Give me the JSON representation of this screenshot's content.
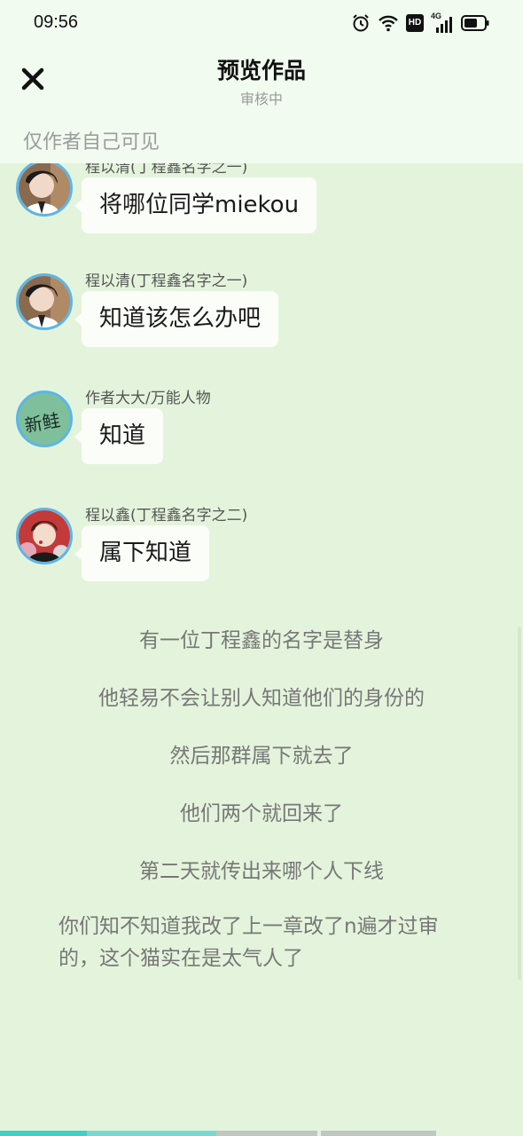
{
  "status_bar": {
    "time": "09:56",
    "icons": [
      "alarm-icon",
      "wifi-icon",
      "hd-icon",
      "signal-4g-icon",
      "battery-icon"
    ],
    "network_label": "4G",
    "hd_label": "HD"
  },
  "header": {
    "close_icon": "close-icon",
    "title": "预览作品",
    "subtitle": "审核中",
    "visibility": "仅作者自己可见"
  },
  "messages": [
    {
      "name": "程以清(丁程鑫名字之一)",
      "text": "将哪位同学miekou",
      "avatar": "avatar-boy-dark-hair"
    },
    {
      "name": "程以清(丁程鑫名字之一)",
      "text": "知道该怎么办吧",
      "avatar": "avatar-boy-dark-hair"
    },
    {
      "name": "作者大大/万能人物",
      "text": "知道",
      "avatar": "avatar-green-calligraphy"
    },
    {
      "name": "程以鑫(丁程鑫名字之二)",
      "text": "属下知道",
      "avatar": "avatar-boy-red-bg"
    }
  ],
  "narration": [
    "有一位丁程鑫的名字是替身",
    "他轻易不会让别人知道他们的身份的",
    "然后那群属下就去了",
    "他们两个就回来了",
    "第二天就传出来哪个人下线",
    "你们知不知道我改了上一章改了n遍才过审的，这个猫实在是太气人了"
  ],
  "avatar_text": "新鲑",
  "colors": {
    "background": "#e4f4dc",
    "header_bg": "#f1fbef",
    "bubble_bg": "#fbfdf9",
    "avatar_border": "#5bb6e8",
    "narration_text": "#777777",
    "progress_colors": [
      "#3fd0c8",
      "#7ad8d4",
      "#c0c6c0"
    ]
  }
}
